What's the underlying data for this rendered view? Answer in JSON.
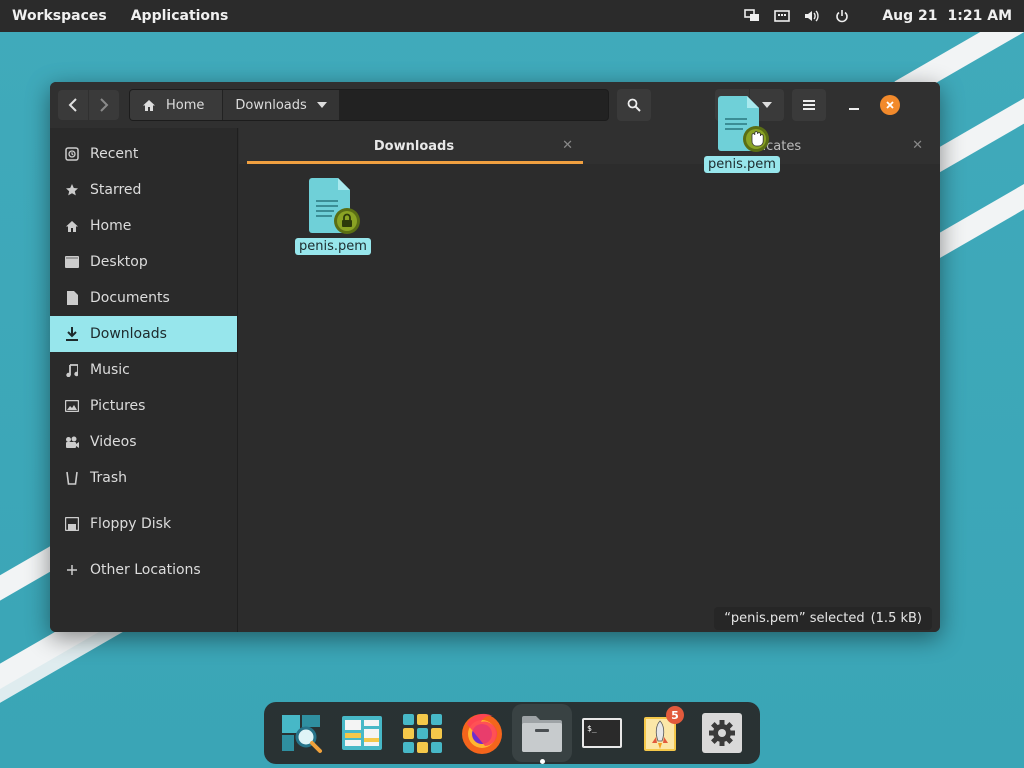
{
  "top_panel": {
    "workspaces": "Workspaces",
    "applications": "Applications",
    "date": "Aug 21",
    "time": "1:21 AM",
    "icons": [
      "screens-icon",
      "keyboard-icon",
      "volume-icon",
      "power-icon"
    ]
  },
  "window": {
    "path": {
      "home": "Home",
      "downloads": "Downloads"
    },
    "tabs": [
      {
        "label": "Downloads",
        "active": true
      },
      {
        "label": "Certificates",
        "active": false
      }
    ],
    "sidebar": {
      "items": [
        {
          "label": "Recent",
          "icon": "recent-icon"
        },
        {
          "label": "Starred",
          "icon": "star-icon"
        },
        {
          "label": "Home",
          "icon": "home-icon"
        },
        {
          "label": "Desktop",
          "icon": "desktop-icon"
        },
        {
          "label": "Documents",
          "icon": "document-icon"
        },
        {
          "label": "Downloads",
          "icon": "download-icon",
          "active": true
        },
        {
          "label": "Music",
          "icon": "music-icon"
        },
        {
          "label": "Pictures",
          "icon": "pictures-icon"
        },
        {
          "label": "Videos",
          "icon": "videos-icon"
        },
        {
          "label": "Trash",
          "icon": "trash-icon"
        }
      ],
      "devices": [
        {
          "label": "Floppy Disk",
          "icon": "floppy-icon"
        }
      ],
      "other": {
        "label": "Other Locations",
        "icon": "plus-icon"
      }
    },
    "files": [
      {
        "name": "penis.pem",
        "selected": true
      }
    ],
    "drag_ghost": {
      "name": "penis.pem"
    },
    "status": {
      "text": "“penis.pem” selected",
      "size": "(1.5 kB)"
    }
  },
  "dock": {
    "items": [
      {
        "name": "search-app",
        "running": false
      },
      {
        "name": "workspaces-app",
        "running": false
      },
      {
        "name": "app-grid",
        "running": false
      },
      {
        "name": "firefox",
        "running": false
      },
      {
        "name": "files",
        "running": true
      },
      {
        "name": "terminal",
        "running": false
      },
      {
        "name": "pop-shop",
        "running": false,
        "badge": "5"
      },
      {
        "name": "settings",
        "running": false
      }
    ]
  },
  "colors": {
    "accent": "#97e6ec",
    "tab_underline": "#f0a040",
    "close": "#f28a2c",
    "badge": "#e25a3c"
  }
}
